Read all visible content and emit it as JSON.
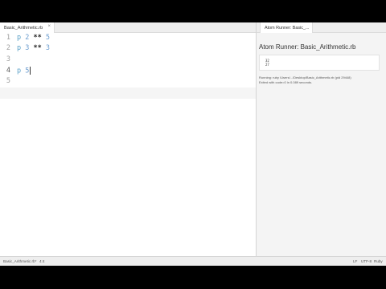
{
  "editor": {
    "tab_label": "Basic_Arithmetic.rb",
    "tab_close": "×",
    "line_numbers": [
      "1",
      "2",
      "3",
      "4",
      "5"
    ],
    "lines": [
      {
        "kw": "p",
        "a": "2",
        "op": "**",
        "b": "5"
      },
      {
        "kw": "p",
        "a": "3",
        "op": "**",
        "b": "3"
      },
      {
        "kw": "",
        "a": "",
        "op": "",
        "b": ""
      },
      {
        "kw": "p",
        "a": "5",
        "op": "",
        "b": ""
      },
      {
        "kw": "",
        "a": "",
        "op": "",
        "b": ""
      }
    ],
    "active_line": 4
  },
  "runner": {
    "tab_label": "Atom Runner: Basic_...",
    "title": "Atom Runner: Basic_Arithmetic.rb",
    "output": [
      "32",
      "27"
    ],
    "status_running": "Running: ruby /Users/.../Desktop/Basic_Arithmetic.rb (pid 29448)",
    "status_exit": "Exited with code=0 in 0.089 seconds."
  },
  "statusbar": {
    "file": "Basic_Arithmetic.rb*",
    "position": "4:4",
    "line_ending": "LF",
    "encoding": "UTF-8",
    "grammar": "Ruby"
  }
}
